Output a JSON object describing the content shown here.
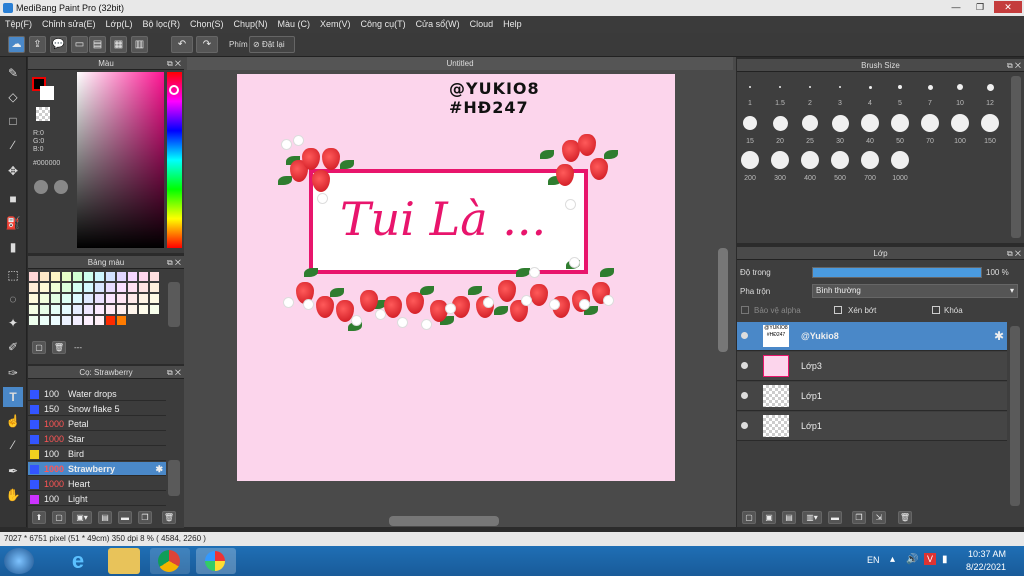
{
  "window": {
    "title": "MediBang Paint Pro (32bit)",
    "min": "—",
    "max": "❐",
    "close": "✕"
  },
  "menu": [
    "Tệp(F)",
    "Chỉnh sửa(E)",
    "Lớp(L)",
    "Bộ lọc(R)",
    "Chọn(S)",
    "Chụp(N)",
    "Màu (C)",
    "Xem(V)",
    "Công cụ(T)",
    "Cửa sổ(W)",
    "Cloud",
    "Help"
  ],
  "toolbar": {
    "prim_label": "Phím",
    "reset_label": "Đặt lại"
  },
  "color_panel": {
    "title": "Màu",
    "r": "R:0",
    "g": "G:0",
    "b": "B:0",
    "hex": "#000000"
  },
  "palette_panel": {
    "title": "Bảng màu",
    "value": "---"
  },
  "brush_panel": {
    "title": "Cọ: Strawberry",
    "items": [
      {
        "size": "100",
        "name": "Water drops",
        "color": "#3355ff",
        "red": false
      },
      {
        "size": "150",
        "name": "Snow flake 5",
        "color": "#3355ff",
        "red": false
      },
      {
        "size": "1000",
        "name": "Petal",
        "color": "#3355ff",
        "red": true
      },
      {
        "size": "1000",
        "name": "Star",
        "color": "#3355ff",
        "red": true
      },
      {
        "size": "100",
        "name": "Bird",
        "color": "#f0d020",
        "red": false
      },
      {
        "size": "1000",
        "name": "Strawberry",
        "color": "#3355ff",
        "red": true
      },
      {
        "size": "1000",
        "name": "Heart",
        "color": "#3355ff",
        "red": true
      },
      {
        "size": "100",
        "name": "Light",
        "color": "#cc33ff",
        "red": false
      }
    ]
  },
  "canvas": {
    "title": "Untitled",
    "sig1": "@YUKIO8",
    "sig2": "#HĐ247",
    "text": "Tui Là ..."
  },
  "brush_size_panel": {
    "title": "Brush Size",
    "sizes": [
      "1",
      "1.5",
      "2",
      "3",
      "4",
      "5",
      "7",
      "10",
      "12",
      "15",
      "20",
      "25",
      "30",
      "40",
      "50",
      "70",
      "100",
      "150",
      "200",
      "300",
      "400",
      "500",
      "700",
      "1000"
    ]
  },
  "layer_panel": {
    "title": "Lớp",
    "opacity_label": "Độ trong",
    "opacity_value": "100 %",
    "opacity_fraction": 1.0,
    "blend_label": "Pha trộn",
    "blend_value": "Bình thường",
    "protect_alpha": "Bảo vệ alpha",
    "clipping": "Xén bớt",
    "lock": "Khóa",
    "layers": [
      {
        "name": "@Yukio8",
        "selected": true
      },
      {
        "name": "Lớp3",
        "selected": false
      },
      {
        "name": "Lớp1",
        "selected": false
      },
      {
        "name": "Lớp1",
        "selected": false
      }
    ]
  },
  "status": {
    "text": "7027 * 6751 pixel   (51 * 49cm)   350 dpi   8 %   ( 4584, 2260 )"
  },
  "taskbar": {
    "lang": "EN",
    "time": "10:37 AM",
    "date": "8/22/2021"
  }
}
